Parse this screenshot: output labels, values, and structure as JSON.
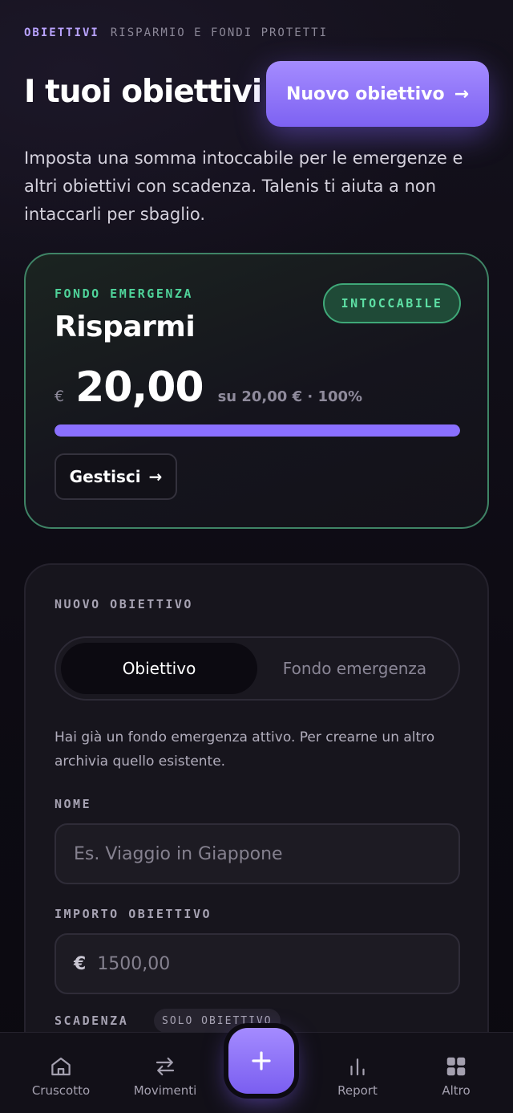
{
  "header": {
    "eyebrow_primary": "OBIETTIVI",
    "eyebrow_secondary": "RISPARMIO E FONDI PROTETTI",
    "title": "I tuoi obiettivi",
    "new_goal_label": "Nuovo obiettivo",
    "new_goal_arrow": "→"
  },
  "intro_text": "Imposta una somma intoccabile per le emergenze e altri obiettivi con scadenza. Talenis ti aiuta a non intaccarli per sbaglio.",
  "emergency_fund": {
    "label": "FONDO EMERGENZA",
    "name": "Risparmi",
    "badge": "INTOCCABILE",
    "currency": "€",
    "amount": "20,00",
    "subtitle": "su 20,00 € · 100%",
    "progress_percent": 100,
    "manage_label": "Gestisci",
    "manage_arrow": "→"
  },
  "new_goal_form": {
    "section_label": "NUOVO OBIETTIVO",
    "type_options": [
      "Obiettivo",
      "Fondo emergenza"
    ],
    "selected_type": "Obiettivo",
    "notice": "Hai già un fondo emergenza attivo. Per crearne un altro archivia quello esistente.",
    "name_label": "NOME",
    "name_placeholder": "Es. Viaggio in Giappone",
    "amount_label": "IMPORTO OBIETTIVO",
    "amount_currency": "€",
    "amount_placeholder": "1500,00",
    "deadline_label": "SCADENZA",
    "deadline_chip": "SOLO OBIETTIVO"
  },
  "bottom_nav": {
    "items": [
      {
        "label": "Cruscotto",
        "icon": "home-icon"
      },
      {
        "label": "Movimenti",
        "icon": "swap-icon"
      },
      {
        "label": "Report",
        "icon": "bar-chart-icon"
      },
      {
        "label": "Altro",
        "icon": "grid-icon"
      }
    ],
    "fab_icon": "plus-icon"
  },
  "colors": {
    "accent": "#8a70ff",
    "success": "#4fd39a",
    "background": "#100d18"
  }
}
